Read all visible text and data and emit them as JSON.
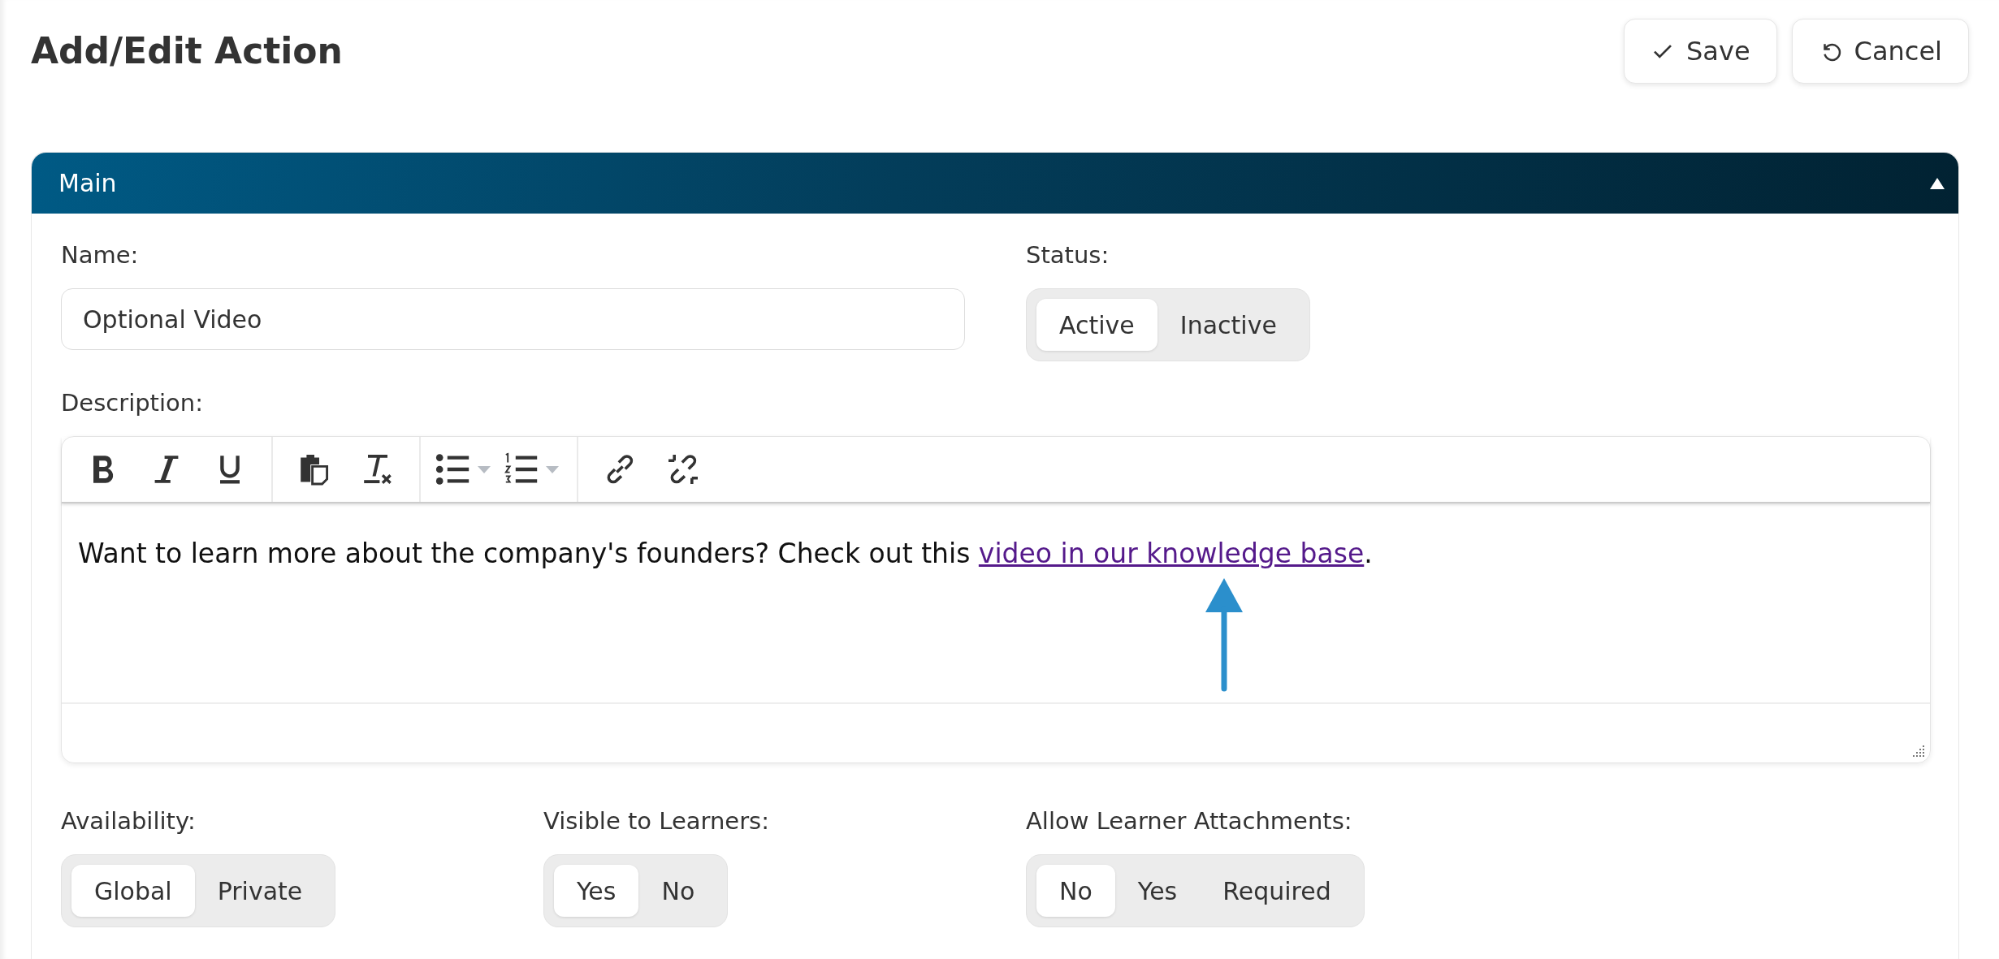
{
  "page": {
    "title": "Add/Edit Action"
  },
  "actions": [
    {
      "kind": "save",
      "label": "Save"
    },
    {
      "kind": "cancel",
      "label": "Cancel"
    }
  ],
  "panel": {
    "title": "Main",
    "expanded": true
  },
  "name": {
    "label": "Name:",
    "value": "Optional Video"
  },
  "status": {
    "label": "Status:",
    "options": [
      {
        "label": "Active",
        "selected": true
      },
      {
        "label": "Inactive",
        "selected": false
      }
    ]
  },
  "description": {
    "label": "Description:",
    "text_before": "Want to learn more about the company's founders? Check out this ",
    "link": "video in our knowledge base",
    "text_after": "."
  },
  "toggles": [
    {
      "label": "Availability:",
      "options": [
        {
          "label": "Global",
          "selected": true
        },
        {
          "label": "Private",
          "selected": false
        }
      ]
    },
    {
      "label": "Visible to Learners:",
      "options": [
        {
          "label": "Yes",
          "selected": true
        },
        {
          "label": "No",
          "selected": false
        }
      ]
    },
    {
      "label": "Allow Learner Attachments:",
      "options": [
        {
          "label": "No",
          "selected": true
        },
        {
          "label": "Yes",
          "selected": false
        },
        {
          "label": "Required",
          "selected": false
        }
      ]
    }
  ]
}
